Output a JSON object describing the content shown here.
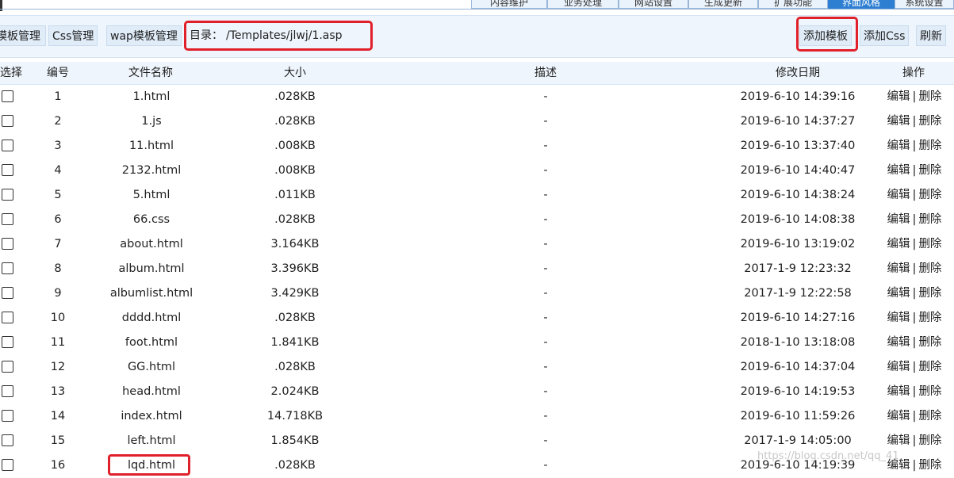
{
  "nav": {
    "tabs": [
      {
        "label": "内容维护",
        "active": false
      },
      {
        "label": "业务处理",
        "active": false
      },
      {
        "label": "网站设置",
        "active": false
      },
      {
        "label": "生成更新",
        "active": false
      },
      {
        "label": "扩展功能",
        "active": false
      },
      {
        "label": "界面风格",
        "active": true
      },
      {
        "label": "系统设置",
        "active": false
      }
    ]
  },
  "toolbar": {
    "template_manage": "模板管理",
    "css_manage": "Css管理",
    "wap_manage": "wap模板管理",
    "directory_label": "目录：",
    "directory_path": "/Templates/jlwj/1.asp",
    "add_template": "添加模板",
    "add_css": "添加Css",
    "refresh": "刷新"
  },
  "table": {
    "headers": {
      "select": "选择",
      "number": "编号",
      "filename": "文件名称",
      "size": "大小",
      "description": "描述",
      "modified": "修改日期",
      "actions": "操作"
    },
    "edit_label": "编辑",
    "separator": "|",
    "delete_label": "删除",
    "rows": [
      {
        "no": "1",
        "name": "1.html",
        "size": ".028KB",
        "desc": "-",
        "date": "2019-6-10 14:39:16"
      },
      {
        "no": "2",
        "name": "1.js",
        "size": ".028KB",
        "desc": "-",
        "date": "2019-6-10 14:37:27"
      },
      {
        "no": "3",
        "name": "11.html",
        "size": ".008KB",
        "desc": "-",
        "date": "2019-6-10 13:37:40"
      },
      {
        "no": "4",
        "name": "2132.html",
        "size": ".008KB",
        "desc": "-",
        "date": "2019-6-10 14:40:47"
      },
      {
        "no": "5",
        "name": "5.html",
        "size": ".011KB",
        "desc": "-",
        "date": "2019-6-10 14:38:24"
      },
      {
        "no": "6",
        "name": "66.css",
        "size": ".028KB",
        "desc": "-",
        "date": "2019-6-10 14:08:38"
      },
      {
        "no": "7",
        "name": "about.html",
        "size": "3.164KB",
        "desc": "-",
        "date": "2019-6-10 13:19:02"
      },
      {
        "no": "8",
        "name": "album.html",
        "size": "3.396KB",
        "desc": "-",
        "date": "2017-1-9 12:23:32"
      },
      {
        "no": "9",
        "name": "albumlist.html",
        "size": "3.429KB",
        "desc": "-",
        "date": "2017-1-9 12:22:58"
      },
      {
        "no": "10",
        "name": "dddd.html",
        "size": ".028KB",
        "desc": "-",
        "date": "2019-6-10 14:27:16"
      },
      {
        "no": "11",
        "name": "foot.html",
        "size": "1.841KB",
        "desc": "-",
        "date": "2018-1-10 13:18:08"
      },
      {
        "no": "12",
        "name": "GG.html",
        "size": ".028KB",
        "desc": "-",
        "date": "2019-6-10 14:37:04"
      },
      {
        "no": "13",
        "name": "head.html",
        "size": "2.024KB",
        "desc": "-",
        "date": "2019-6-10 14:19:53"
      },
      {
        "no": "14",
        "name": "index.html",
        "size": "14.718KB",
        "desc": "-",
        "date": "2019-6-10 11:59:26"
      },
      {
        "no": "15",
        "name": "left.html",
        "size": "1.854KB",
        "desc": "-",
        "date": "2017-1-9 14:05:00"
      },
      {
        "no": "16",
        "name": "lqd.html",
        "size": ".028KB",
        "desc": "-",
        "date": "2019-6-10 14:19:39"
      }
    ]
  },
  "watermark": "https://blog.csdn.net/qq_41"
}
